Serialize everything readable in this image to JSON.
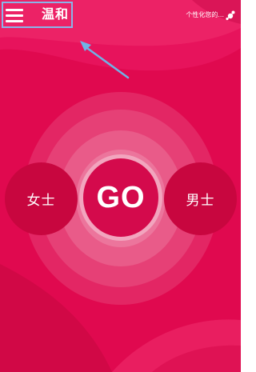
{
  "header": {
    "mode_label": "温和",
    "personalize_label": "个性化您的..."
  },
  "main": {
    "go_label": "GO",
    "female_label": "女士",
    "male_label": "男士"
  },
  "colors": {
    "background": "#e0094f",
    "button": "#c8063f",
    "highlight_border": "#8ab4e8",
    "arrow": "#6fb3e6"
  }
}
